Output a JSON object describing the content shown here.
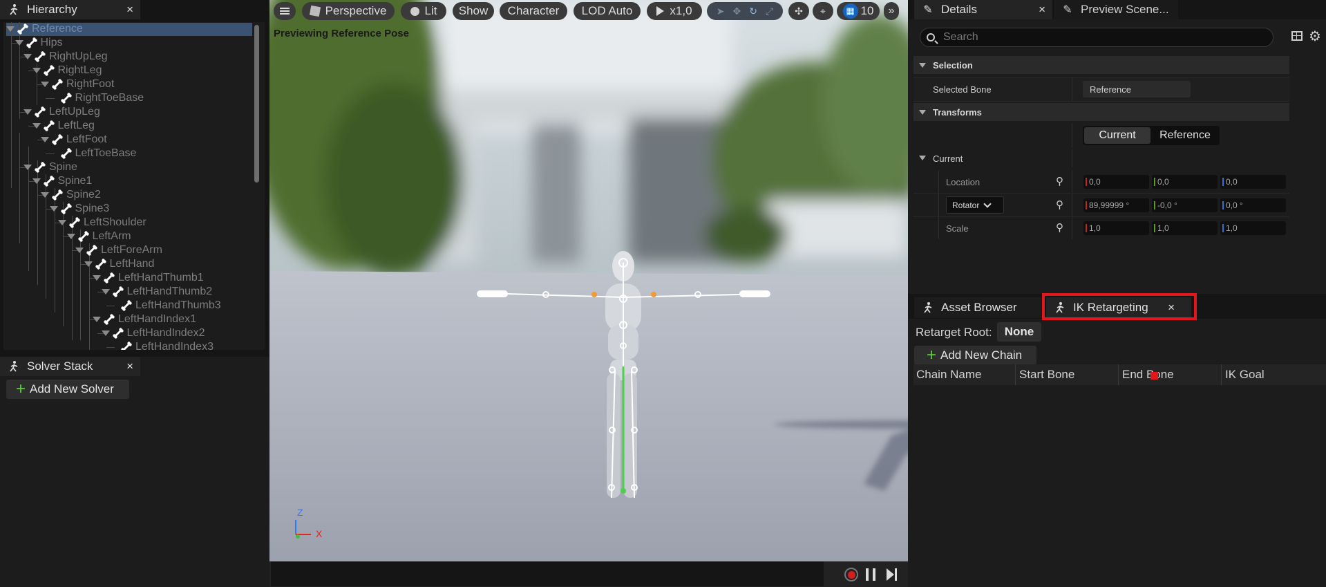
{
  "hierarchy": {
    "tab_label": "Hierarchy",
    "close": "×",
    "bones": [
      "Reference",
      "Hips",
      "RightUpLeg",
      "RightLeg",
      "RightFoot",
      "RightToeBase",
      "LeftUpLeg",
      "LeftLeg",
      "LeftFoot",
      "LeftToeBase",
      "Spine",
      "Spine1",
      "Spine2",
      "Spine3",
      "LeftShoulder",
      "LeftArm",
      "LeftForeArm",
      "LeftHand",
      "LeftHandThumb1",
      "LeftHandThumb2",
      "LeftHandThumb3",
      "LeftHandIndex1",
      "LeftHandIndex2",
      "LeftHandIndex3"
    ]
  },
  "solver_stack": {
    "tab_label": "Solver Stack",
    "close": "×",
    "add_button": "Add New Solver"
  },
  "viewport": {
    "menu_icon": "hamburger-icon",
    "perspective": "Perspective",
    "lit": "Lit",
    "show": "Show",
    "character": "Character",
    "lod": "LOD Auto",
    "play_speed": "x1,0",
    "grid_value": "10",
    "overlay_text": "Previewing Reference Pose",
    "axis_z": "Z",
    "axis_x": "X",
    "colors": {
      "floor": "#a9aebb",
      "sky": "#c9d2d6",
      "accent_blue": "#1565c0",
      "record_red": "#d02020"
    }
  },
  "details": {
    "tab_label": "Details",
    "tab2_label": "Preview Scene...",
    "close": "×",
    "search_placeholder": "Search",
    "section_selection": "Selection",
    "selected_bone_label": "Selected Bone",
    "selected_bone_value": "Reference",
    "section_transforms": "Transforms",
    "toggle_current": "Current",
    "toggle_reference": "Reference",
    "section_current": "Current",
    "location_label": "Location",
    "location": [
      "0,0",
      "0,0",
      "0,0"
    ],
    "rotator_label": "Rotator",
    "rotation": [
      "89,99999 °",
      "-0,0 °",
      "0,0 °"
    ],
    "scale_label": "Scale",
    "scale": [
      "1,0",
      "1,0",
      "1,0"
    ]
  },
  "retarget": {
    "tab_asset_browser": "Asset Browser",
    "tab_ik": "IK Retargeting",
    "close": "×",
    "root_label": "Retarget Root:",
    "root_value": "None",
    "add_chain": "Add New Chain",
    "columns": [
      "Chain Name",
      "Start Bone",
      "End Bone",
      "IK Goal"
    ],
    "highlight_color": "#e3161c"
  }
}
